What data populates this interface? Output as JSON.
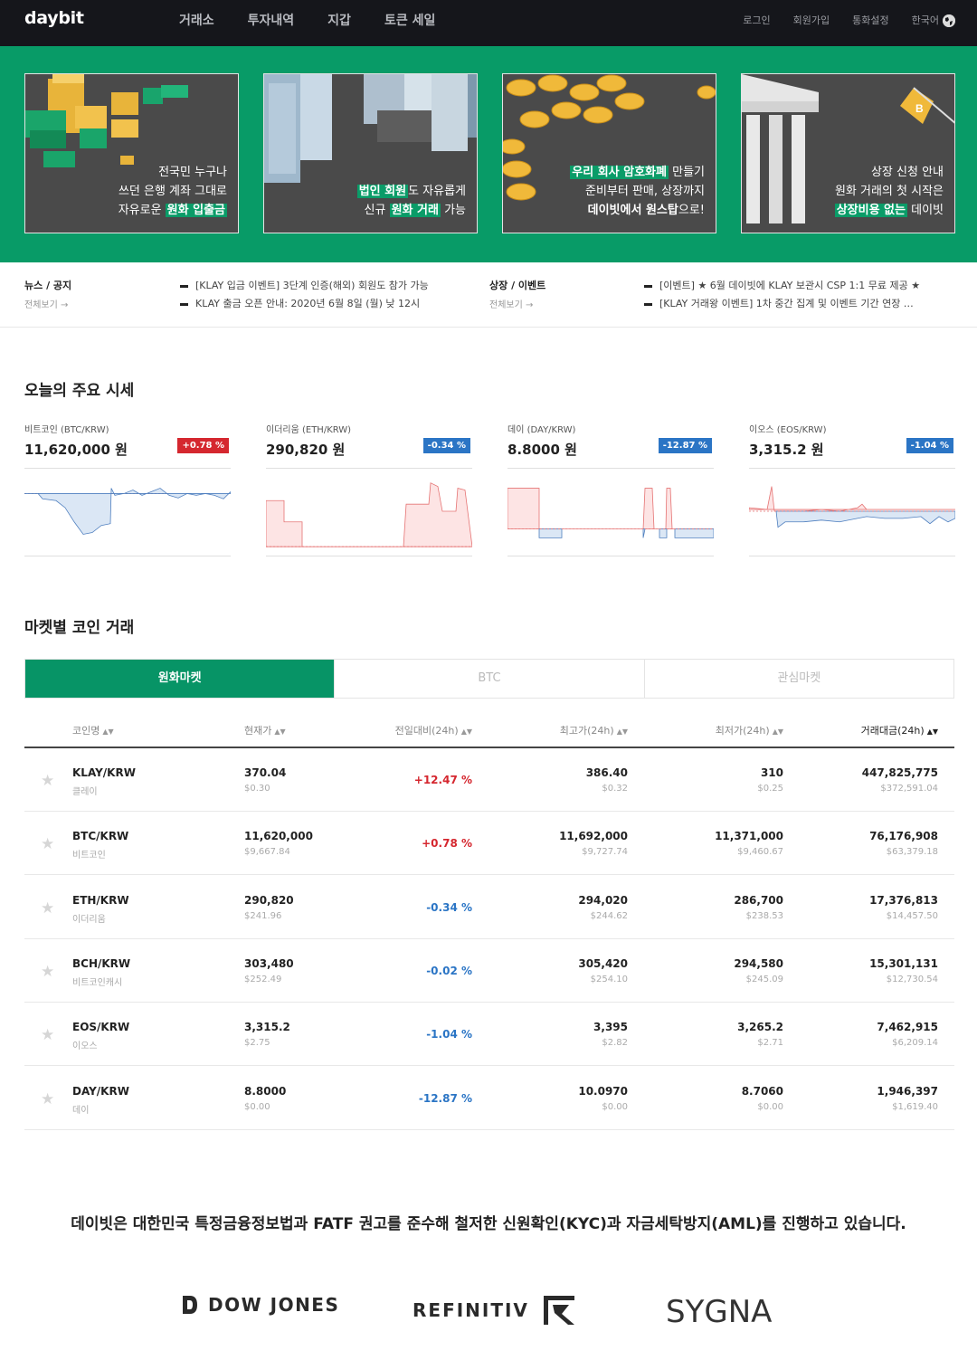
{
  "header": {
    "logo": "daybit",
    "nav": [
      "거래소",
      "투자내역",
      "지갑",
      "토큰 세일"
    ],
    "right": [
      "로그인",
      "회원가입",
      "통화설정",
      "한국어"
    ]
  },
  "hero": {
    "cards": [
      {
        "l1": "전국민 누구나",
        "l2": "쓰던 은행 계좌 그대로",
        "l3a": "자유로운 ",
        "l3b": "원화 입출금"
      },
      {
        "l1a": "법인 회원",
        "l1b": "도 자유롭게",
        "l2a": "신규 ",
        "l2b": "원화 거래",
        "l2c": " 가능"
      },
      {
        "l1a": "우리 회사 암호화폐",
        "l1b": " 만들기",
        "l2": "준비부터 판매, 상장까지",
        "l3a": "데이빗에서 원스탑",
        "l3b": "으로!"
      },
      {
        "l1": "상장 신청 안내",
        "l2": "원화 거래의 첫 시작은",
        "l3a": "상장비용 없는",
        "l3b": " 데이빗"
      }
    ]
  },
  "news": {
    "notice_title": "뉴스 / 공지",
    "notice_more": "전체보기 →",
    "notice_items": [
      "[KLAY 입금 이벤트] 3단계 인증(해외) 회원도 참가 가능",
      "KLAY 출금 오픈 안내: 2020년 6월 8일 (월) 낮 12시"
    ],
    "event_title": "상장 / 이벤트",
    "event_more": "전체보기 →",
    "event_items": [
      "[이벤트] ★ 6월 데이빗에 KLAY 보관시 CSP 1:1 무료 제공 ★",
      "[KLAY 거래왕 이벤트] 1차 중간 집계 및 이벤트 기간 연장 …"
    ]
  },
  "ticker": {
    "title": "오늘의 주요 시세",
    "items": [
      {
        "pair": "비트코인 (BTC/KRW)",
        "price": "11,620,000 원",
        "change": "+0.78 %"
      },
      {
        "pair": "이더리움 (ETH/KRW)",
        "price": "290,820 원",
        "change": "-0.34 %"
      },
      {
        "pair": "데이 (DAY/KRW)",
        "price": "8.8000 원",
        "change": "-12.87 %"
      },
      {
        "pair": "이오스 (EOS/KRW)",
        "price": "3,315.2 원",
        "change": "-1.04 %"
      }
    ]
  },
  "market": {
    "title": "마켓별 코인 거래",
    "tabs": [
      "원화마켓",
      "BTC",
      "관심마켓"
    ],
    "columns": [
      "코인명",
      "현재가",
      "전일대비(24h)",
      "최고가(24h)",
      "최저가(24h)",
      "거래대금(24h)"
    ],
    "rows": [
      {
        "pair": "KLAY/KRW",
        "name": "클레이",
        "price": "370.04",
        "price_usd": "$0.30",
        "change": "+12.47 %",
        "high": "386.40",
        "high_usd": "$0.32",
        "low": "310",
        "low_usd": "$0.25",
        "vol": "447,825,775",
        "vol_usd": "$372,591.04"
      },
      {
        "pair": "BTC/KRW",
        "name": "비트코인",
        "price": "11,620,000",
        "price_usd": "$9,667.84",
        "change": "+0.78 %",
        "high": "11,692,000",
        "high_usd": "$9,727.74",
        "low": "11,371,000",
        "low_usd": "$9,460.67",
        "vol": "76,176,908",
        "vol_usd": "$63,379.18"
      },
      {
        "pair": "ETH/KRW",
        "name": "이더리움",
        "price": "290,820",
        "price_usd": "$241.96",
        "change": "-0.34 %",
        "high": "294,020",
        "high_usd": "$244.62",
        "low": "286,700",
        "low_usd": "$238.53",
        "vol": "17,376,813",
        "vol_usd": "$14,457.50"
      },
      {
        "pair": "BCH/KRW",
        "name": "비트코인캐시",
        "price": "303,480",
        "price_usd": "$252.49",
        "change": "-0.02 %",
        "high": "305,420",
        "high_usd": "$254.10",
        "low": "294,580",
        "low_usd": "$245.09",
        "vol": "15,301,131",
        "vol_usd": "$12,730.54"
      },
      {
        "pair": "EOS/KRW",
        "name": "이오스",
        "price": "3,315.2",
        "price_usd": "$2.75",
        "change": "-1.04 %",
        "high": "3,395",
        "high_usd": "$2.82",
        "low": "3,265.2",
        "low_usd": "$2.71",
        "vol": "7,462,915",
        "vol_usd": "$6,209.14"
      },
      {
        "pair": "DAY/KRW",
        "name": "데이",
        "price": "8.8000",
        "price_usd": "$0.00",
        "change": "-12.87 %",
        "high": "10.0970",
        "high_usd": "$0.00",
        "low": "8.7060",
        "low_usd": "$0.00",
        "vol": "1,946,397",
        "vol_usd": "$1,619.40"
      }
    ]
  },
  "compliance": "데이빗은 대한민국 특정금융정보법과 FATF 권고를 준수해 철저한 신원확인(KYC)과 자금세탁방지(AML)를 진행하고 있습니다.",
  "partners": [
    "DOW JONES",
    "REFINITIV",
    "SYGNA"
  ],
  "colors": {
    "brand_green": "#089b67",
    "up_red": "#d5272f",
    "down_blue": "#2b75c5",
    "topbar": "#15161b"
  }
}
